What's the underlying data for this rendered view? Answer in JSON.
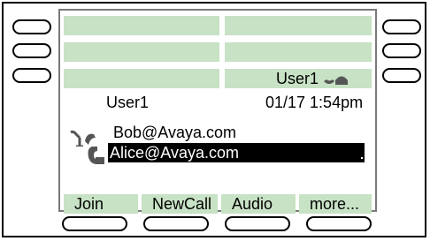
{
  "status_line": {
    "right_user": "User1"
  },
  "header": {
    "user": "User1",
    "datetime": "01/17 1:54pm"
  },
  "calls": [
    {
      "label": "Bob@Avaya.com",
      "selected": false
    },
    {
      "label": "Alice@Avaya.com",
      "selected": true
    }
  ],
  "softkeys": [
    "Join",
    "NewCall",
    "Audio",
    "more..."
  ],
  "colors": {
    "line_bar": "#c7e2c4",
    "selection": "#000000",
    "screen_border": "#7a7a7a"
  },
  "icons": {
    "handset_status": "handset-icon",
    "call_held": "call-on-hold-icon",
    "call_active": "call-active-icon"
  }
}
